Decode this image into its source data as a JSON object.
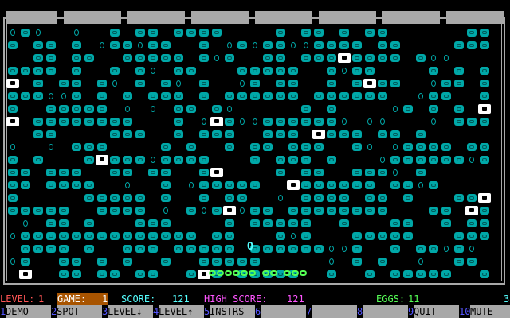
{
  "status": {
    "level_label": "LEVEL:",
    "level_value": "1",
    "game_label": "GAME:",
    "game_value": "1",
    "score_label": "SCORE:",
    "score_value": "121",
    "high_label": "HIGH SCORE:",
    "high_value": "121",
    "eggs_label": "EGGS:",
    "eggs_value": "11",
    "lives": "3",
    "colors": {
      "level": "#ff5555",
      "game_bg": "#a85400",
      "game_text": "#ffffff",
      "score": "#55ffff",
      "high": "#ff55ff",
      "eggs": "#55ff55",
      "lives": "#55ffff"
    }
  },
  "player_glyph": "Q",
  "function_keys": [
    {
      "num": "1",
      "label": "DEMO"
    },
    {
      "num": "2",
      "label": "SPOT"
    },
    {
      "num": "3",
      "label": "LEVEL↓"
    },
    {
      "num": "4",
      "label": "LEVEL↑"
    },
    {
      "num": "5",
      "label": "INSTRS"
    },
    {
      "num": "6",
      "label": ""
    },
    {
      "num": "7",
      "label": ""
    },
    {
      "num": "8",
      "label": ""
    },
    {
      "num": "9",
      "label": "QUIT"
    },
    {
      "num": "10",
      "label": "MUTE"
    }
  ],
  "icons": {
    "block": "cyan-block-icon",
    "egg": "egg-icon",
    "snake": "snake-icon",
    "player": "player-icon"
  }
}
